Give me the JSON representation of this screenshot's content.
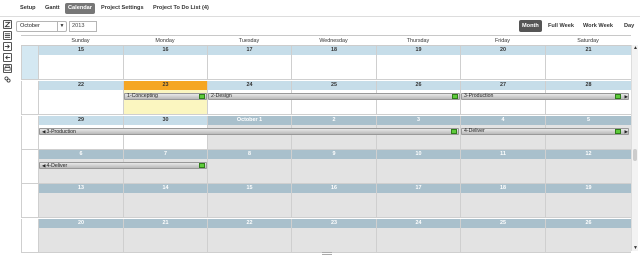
{
  "nav": {
    "tabs": [
      {
        "label": "Setup"
      },
      {
        "label": "Gantt"
      },
      {
        "label": "Calendar"
      },
      {
        "label": "Project Settings"
      },
      {
        "label": "Project To Do List (4)"
      }
    ],
    "active_tab": "Calendar"
  },
  "selectors": {
    "month": "October",
    "year": "2013"
  },
  "views": [
    {
      "label": "Month"
    },
    {
      "label": "Full Week"
    },
    {
      "label": "Work Week"
    },
    {
      "label": "Day"
    }
  ],
  "left_tools": [
    {
      "icon": "calendar-z-icon"
    },
    {
      "icon": "list-icon"
    },
    {
      "icon": "import-icon"
    },
    {
      "icon": "export-icon"
    },
    {
      "icon": "printer-icon"
    },
    {
      "icon": "link-icon"
    }
  ],
  "calendar": {
    "weekdays": [
      "Sunday",
      "Monday",
      "Tuesday",
      "Wednesday",
      "Thursday",
      "Friday",
      "Saturday"
    ],
    "weeks": [
      [
        "15",
        "16",
        "17",
        "18",
        "19",
        "20",
        "21"
      ],
      [
        "22",
        "23",
        "24",
        "25",
        "26",
        "27",
        "28"
      ],
      [
        "29",
        "30",
        "October 1",
        "2",
        "3",
        "4",
        "5"
      ],
      [
        "6",
        "7",
        "8",
        "9",
        "10",
        "11",
        "12"
      ],
      [
        "13",
        "14",
        "15",
        "16",
        "17",
        "18",
        "19"
      ],
      [
        "20",
        "21",
        "22",
        "23",
        "24",
        "25",
        "26"
      ]
    ],
    "events": [
      {
        "label": "1-Concepting"
      },
      {
        "label": "2-Design"
      },
      {
        "label": "3-Production"
      },
      {
        "label": "3-Production"
      },
      {
        "label": "4-Deliver"
      },
      {
        "label": "4-Deliver"
      }
    ],
    "colors": {
      "header_band": "#c6dde9",
      "other_month_band": "#a9c0cc",
      "today": "#f5a623",
      "event_status": "#5ecb3b"
    }
  }
}
